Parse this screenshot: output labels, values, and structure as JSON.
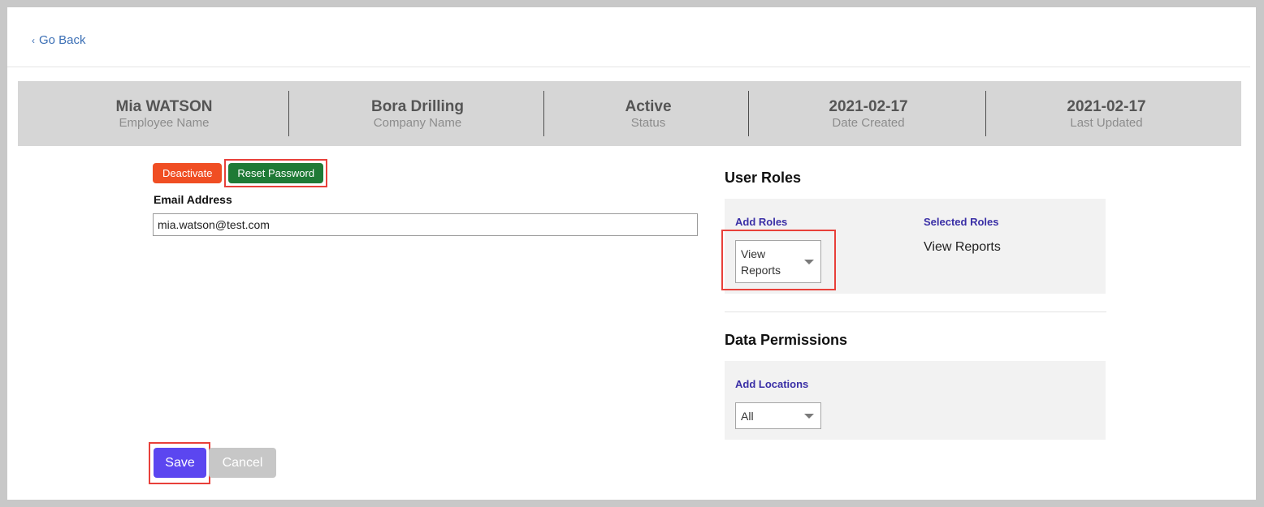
{
  "nav": {
    "go_back_label": "Go Back"
  },
  "info_bar": {
    "employee_name": {
      "value": "Mia WATSON",
      "label": "Employee Name"
    },
    "company_name": {
      "value": "Bora Drilling",
      "label": "Company Name"
    },
    "status": {
      "value": "Active",
      "label": "Status"
    },
    "date_created": {
      "value": "2021-02-17",
      "label": "Date Created"
    },
    "last_updated": {
      "value": "2021-02-17",
      "label": "Last Updated"
    }
  },
  "actions": {
    "deactivate_label": "Deactivate",
    "reset_password_label": "Reset Password"
  },
  "email": {
    "label": "Email Address",
    "value": "mia.watson@test.com"
  },
  "user_roles": {
    "title": "User Roles",
    "add_roles_label": "Add Roles",
    "add_roles_selected": "View Reports",
    "selected_roles_label": "Selected Roles",
    "selected_roles": [
      "View Reports"
    ]
  },
  "data_permissions": {
    "title": "Data Permissions",
    "add_locations_label": "Add Locations",
    "add_locations_selected": "All"
  },
  "footer": {
    "save_label": "Save",
    "cancel_label": "Cancel"
  },
  "colors": {
    "deactivate": "#f04e23",
    "reset_password": "#1f7a36",
    "save": "#5b46f0",
    "cancel": "#c7c7c7",
    "highlight": "#e8403a",
    "panel_label": "#3a2fa6"
  }
}
